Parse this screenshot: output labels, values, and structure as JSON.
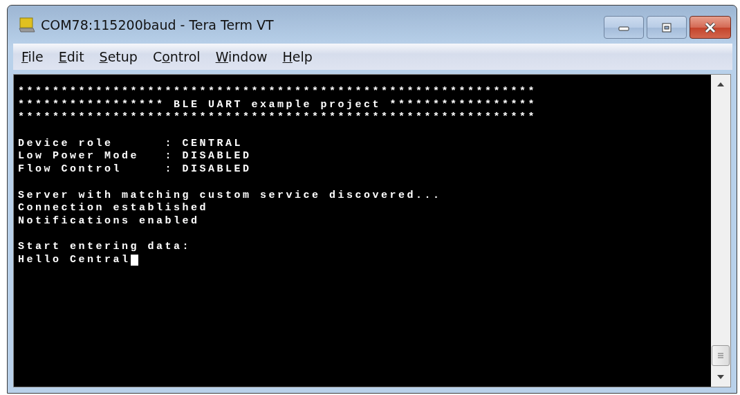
{
  "window": {
    "title": "COM78:115200baud - Tera Term VT"
  },
  "menu": [
    {
      "accel": "F",
      "rest": "ile"
    },
    {
      "accel": "E",
      "rest": "dit"
    },
    {
      "accel": "S",
      "rest": "etup"
    },
    {
      "pre": "C",
      "accel": "o",
      "rest": "ntrol"
    },
    {
      "accel": "W",
      "rest": "indow"
    },
    {
      "accel": "H",
      "rest": "elp"
    }
  ],
  "terminal": {
    "blocks": [
      [
        "************************************************************",
        "***************** BLE UART example project *****************",
        "************************************************************"
      ],
      [
        "Device role      : CENTRAL",
        "Low Power Mode   : DISABLED",
        "Flow Control     : DISABLED"
      ],
      [
        "Server with matching custom service discovered...",
        "Connection established",
        "Notifications enabled"
      ],
      [
        "Start entering data:",
        "Hello Central"
      ]
    ],
    "cursor_visible": true
  }
}
